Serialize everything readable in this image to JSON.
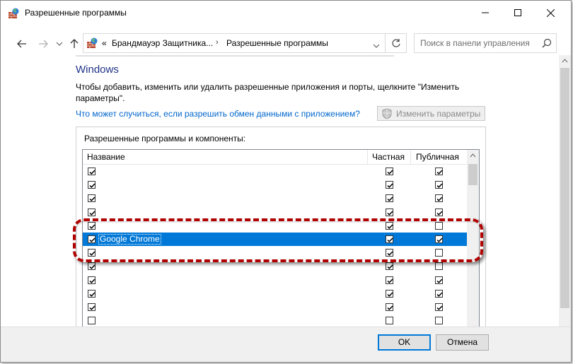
{
  "window": {
    "title": "Разрешенные программы"
  },
  "nav": {
    "breadcrumb_overflow": "«",
    "breadcrumb": [
      "Брандмауэр Защитника...",
      "Разрешенные программы"
    ],
    "search_placeholder": "Поиск в панели управления"
  },
  "content": {
    "heading": "Windows",
    "description": "Чтобы добавить, изменить или удалить разрешенные приложения и порты, щелкните \"Изменить параметры\".",
    "risk_link": "Что может случиться, если разрешить обмен данными с приложением?",
    "change_settings_button": "Изменить параметры",
    "group_label": "Разрешенные программы и компоненты:",
    "columns": {
      "name": "Название",
      "private": "Частная",
      "public": "Публичная"
    },
    "rows": [
      {
        "name": "",
        "checked": true,
        "private": true,
        "public": true
      },
      {
        "name": "",
        "checked": true,
        "private": true,
        "public": true
      },
      {
        "name": "",
        "checked": true,
        "private": true,
        "public": true
      },
      {
        "name": "",
        "checked": true,
        "private": true,
        "public": true
      },
      {
        "name": "",
        "checked": true,
        "private": true,
        "public": false
      },
      {
        "name": "Google Chrome",
        "checked": true,
        "private": true,
        "public": true,
        "selected": true
      },
      {
        "name": "",
        "checked": true,
        "private": true,
        "public": false
      },
      {
        "name": "",
        "checked": true,
        "private": true,
        "public": false
      },
      {
        "name": "",
        "checked": true,
        "private": true,
        "public": true
      },
      {
        "name": "",
        "checked": true,
        "private": true,
        "public": true
      },
      {
        "name": "",
        "checked": true,
        "private": true,
        "public": true
      },
      {
        "name": "",
        "checked": false,
        "private": false,
        "public": false
      }
    ]
  },
  "footer": {
    "ok": "OK",
    "cancel": "Отмена"
  },
  "colors": {
    "selection": "#0078d7",
    "heading": "#1e3287",
    "link": "#0066cc",
    "highlight_annotation": "#b00000"
  }
}
